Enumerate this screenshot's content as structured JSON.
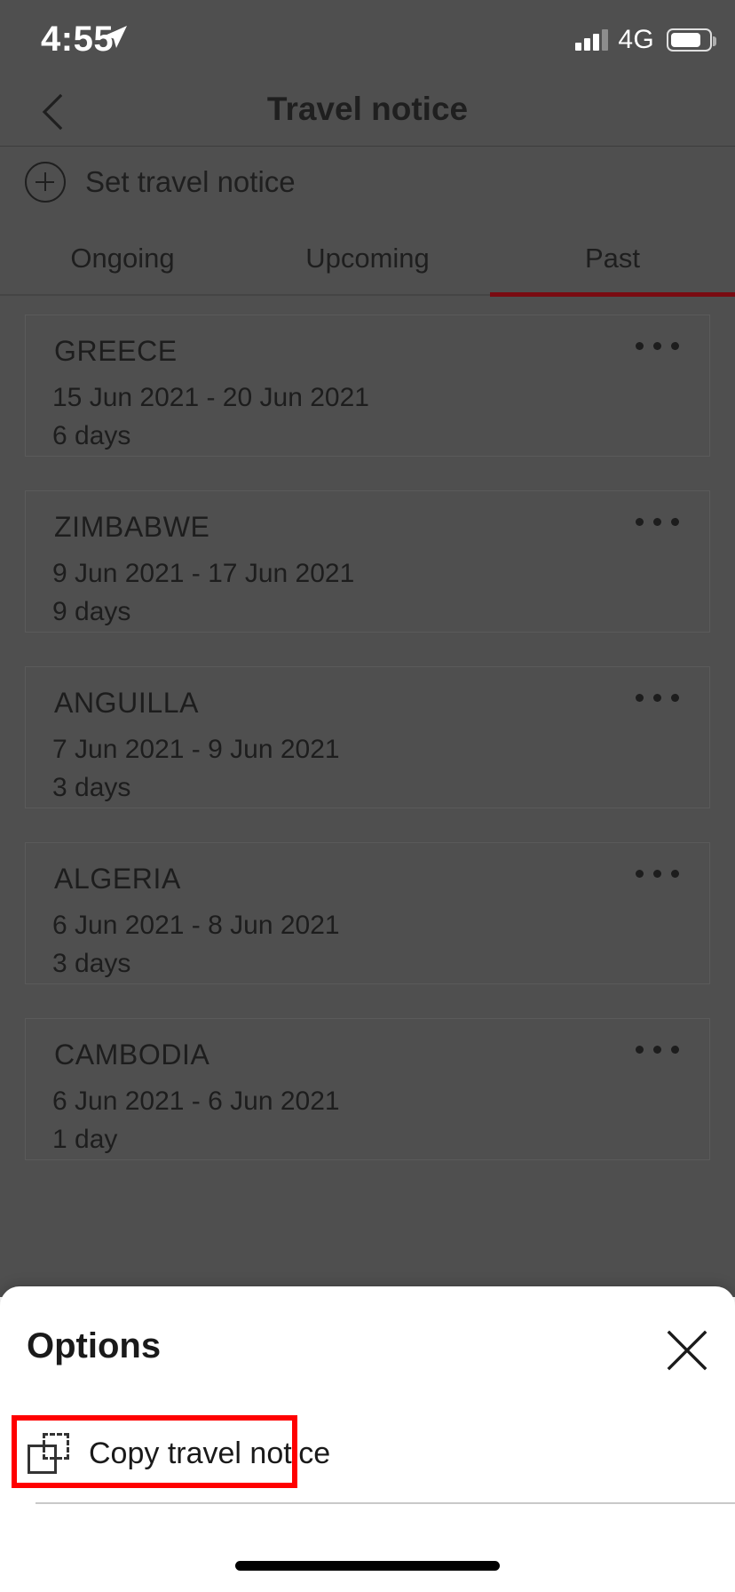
{
  "status_bar": {
    "time": "4:55",
    "location_icon": "location-arrow-icon",
    "network": "4G",
    "signal_icon": "signal-bars-icon",
    "battery_icon": "battery-icon"
  },
  "nav": {
    "back_icon": "chevron-left-icon",
    "title": "Travel notice"
  },
  "set_travel_notice": {
    "icon": "plus-circle-icon",
    "label": "Set travel notice"
  },
  "tabs": {
    "items": [
      {
        "label": "Ongoing",
        "active": false
      },
      {
        "label": "Upcoming",
        "active": false
      },
      {
        "label": "Past",
        "active": true
      }
    ],
    "active_index": 2,
    "active_underline_color": "#7a0b12"
  },
  "notices": [
    {
      "country": "GREECE",
      "dates": "15 Jun 2021 - 20 Jun 2021",
      "duration": "6 days",
      "menu_icon": "overflow-menu-icon"
    },
    {
      "country": "ZIMBABWE",
      "dates": "9 Jun 2021 - 17 Jun 2021",
      "duration": "9 days",
      "menu_icon": "overflow-menu-icon"
    },
    {
      "country": "ANGUILLA",
      "dates": "7 Jun 2021 - 9 Jun 2021",
      "duration": "3 days",
      "menu_icon": "overflow-menu-icon"
    },
    {
      "country": "ALGERIA",
      "dates": "6 Jun 2021 - 8 Jun 2021",
      "duration": "3 days",
      "menu_icon": "overflow-menu-icon"
    },
    {
      "country": "CAMBODIA",
      "dates": "6 Jun 2021 - 6 Jun 2021",
      "duration": "1 day",
      "menu_icon": "overflow-menu-icon"
    }
  ],
  "sheet": {
    "title": "Options",
    "close_icon": "close-icon",
    "items": [
      {
        "label": "Copy travel notice",
        "icon": "copy-icon",
        "highlight_color": "#ff0000"
      }
    ]
  },
  "colors": {
    "overlay_background": "#4f4f4f",
    "sheet_background": "#ffffff",
    "accent_red": "#7a0b12",
    "highlight_red": "#ff0000"
  }
}
